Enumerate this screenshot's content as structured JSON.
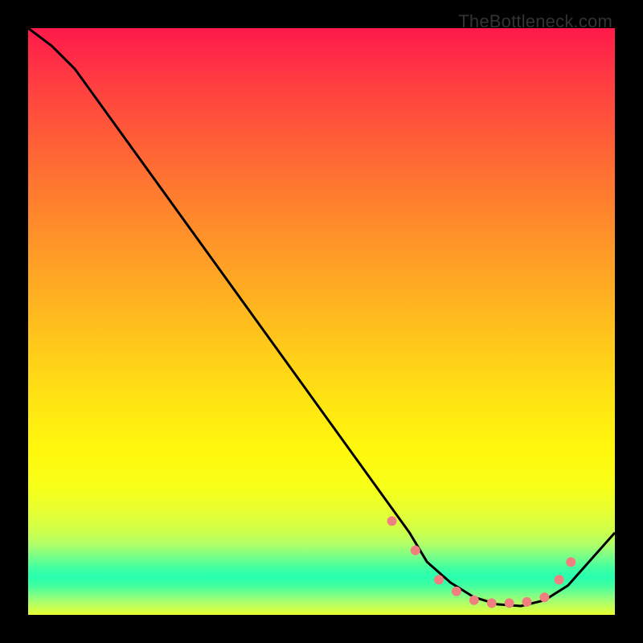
{
  "watermark": "TheBottleneck.com",
  "chart_data": {
    "type": "line",
    "title": "",
    "xlabel": "",
    "ylabel": "",
    "xlim": [
      0,
      100
    ],
    "ylim": [
      0,
      100
    ],
    "grid": false,
    "legend": false,
    "series": [
      {
        "name": "curve",
        "color": "#000000",
        "x": [
          0,
          4,
          8,
          65,
          68,
          72,
          76,
          80,
          84,
          88,
          92,
          100
        ],
        "values": [
          100,
          97,
          93,
          14,
          9,
          5.5,
          3,
          1.8,
          1.5,
          2.5,
          5,
          14
        ]
      }
    ],
    "markers": {
      "name": "dots",
      "color": "#f08080",
      "radius": 6,
      "x": [
        62,
        66,
        70,
        73,
        76,
        79,
        82,
        85,
        88,
        90.5,
        92.5
      ],
      "values": [
        16,
        11,
        6,
        4,
        2.5,
        2,
        2,
        2.2,
        3,
        6,
        9
      ]
    }
  }
}
